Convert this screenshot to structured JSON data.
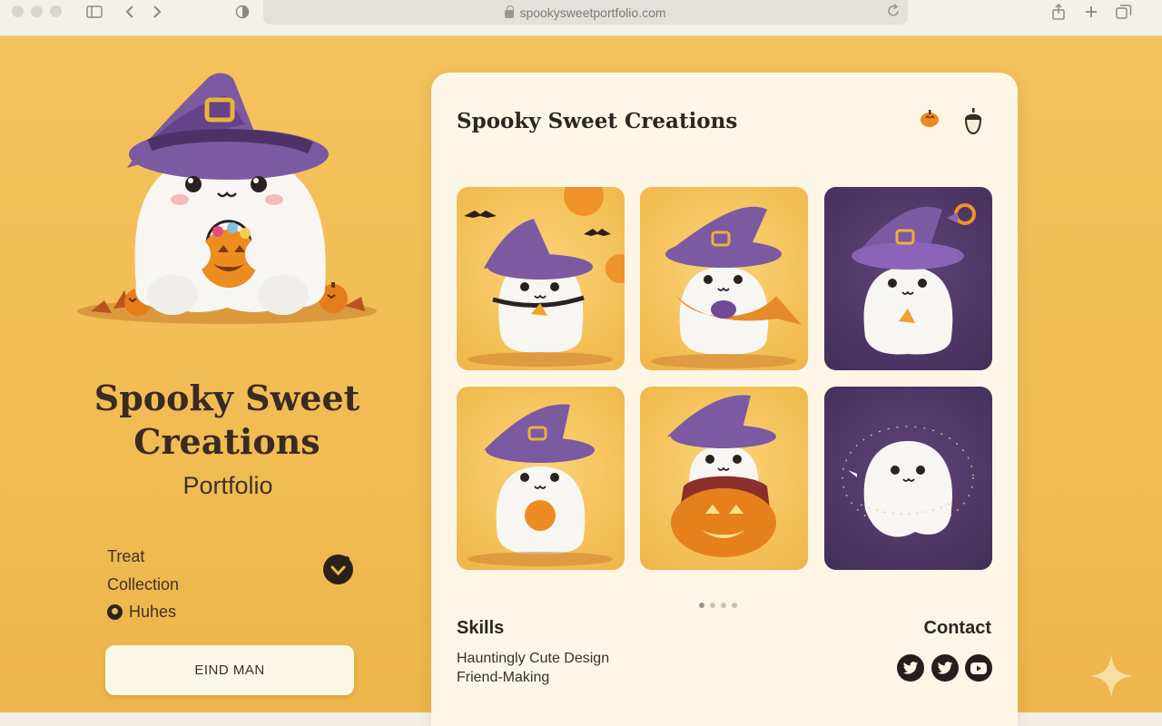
{
  "browser": {
    "url": "spookysweetportfolio.com"
  },
  "hero": {
    "title": "Spooky Sweet Creations",
    "subtitle": "Portfolio",
    "treat_line1": "Treat",
    "treat_line2": "Collection",
    "huhes": "Huhes",
    "cta_label": "EIND MAN"
  },
  "card": {
    "title": "Spooky Sweet Creations",
    "gallery": [
      {
        "name": "ghost-bats-candy-corn",
        "bg": "yellow"
      },
      {
        "name": "ghost-cape-witch",
        "bg": "yellow"
      },
      {
        "name": "ghost-candy-corn-purple",
        "bg": "purple"
      },
      {
        "name": "ghost-candy-bucket",
        "bg": "yellow"
      },
      {
        "name": "ghost-pumpkin-vampire",
        "bg": "yellow"
      },
      {
        "name": "ghost-fairy-lights",
        "bg": "purple"
      }
    ],
    "pager": {
      "pages": 4,
      "current": 1
    },
    "skills_heading": "Skills",
    "skills": [
      "Hauntingly Cute Design",
      "Friend-Making"
    ],
    "contact_heading": "Contact",
    "social_icons": [
      "twitter-icon",
      "twitter-icon",
      "youtube-icon"
    ]
  },
  "colors": {
    "background": "#f2bd55",
    "card": "#fdf6e6",
    "purple": "#4c3563",
    "text_dark": "#2f2520"
  }
}
